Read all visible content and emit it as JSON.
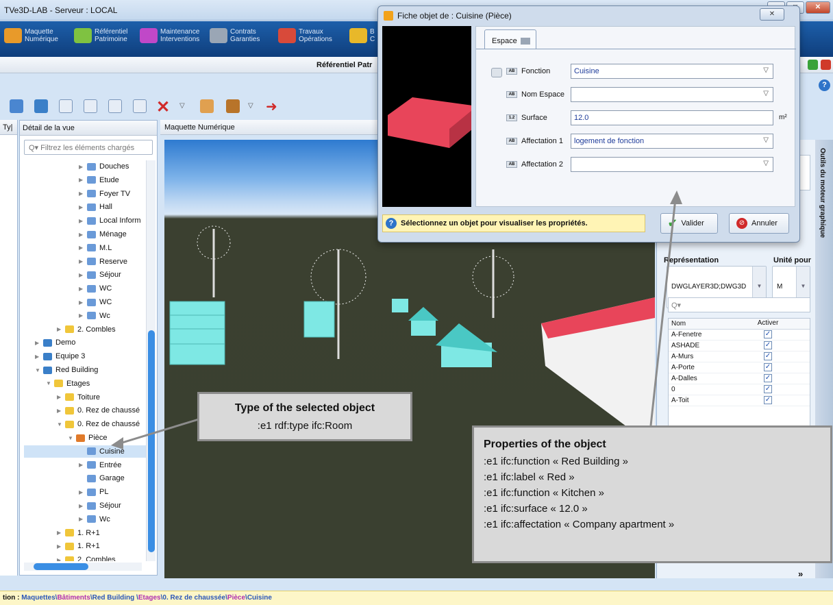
{
  "window": {
    "title": "TVe3D-LAB - Serveur : LOCAL"
  },
  "modules": [
    {
      "line1": "Maquette",
      "line2": "Numérique",
      "color": "#e89a2a"
    },
    {
      "line1": "Référentiel",
      "line2": "Patrimoine",
      "color": "#7fc241"
    },
    {
      "line1": "Maintenance",
      "line2": "Interventions",
      "color": "#c048c8"
    },
    {
      "line1": "Contrats",
      "line2": "Garanties",
      "color": "#9aa6b5"
    },
    {
      "line1": "Travaux",
      "line2": "Opérations",
      "color": "#d84a3a"
    },
    {
      "line1": "B",
      "line2": "C",
      "color": "#e8b82a"
    }
  ],
  "header": {
    "title": "Référentiel Patr"
  },
  "panes": {
    "narrow_title": "Ty|",
    "tree_title": "Détail de la vue",
    "filter_placeholder": "Filtrez les éléments chargés",
    "viewport_title": "Maquette Numérique"
  },
  "tree": [
    {
      "label": "Douches",
      "indent": 80,
      "arrow": "▶",
      "type": "room"
    },
    {
      "label": "Etude",
      "indent": 80,
      "arrow": "▶",
      "type": "room"
    },
    {
      "label": "Foyer TV",
      "indent": 80,
      "arrow": "▶",
      "type": "room"
    },
    {
      "label": "Hall",
      "indent": 80,
      "arrow": "▶",
      "type": "room"
    },
    {
      "label": "Local Inform",
      "indent": 80,
      "arrow": "▶",
      "type": "room"
    },
    {
      "label": "Ménage",
      "indent": 80,
      "arrow": "▶",
      "type": "room"
    },
    {
      "label": "M.L",
      "indent": 80,
      "arrow": "▶",
      "type": "room"
    },
    {
      "label": "Reserve",
      "indent": 80,
      "arrow": "▶",
      "type": "room"
    },
    {
      "label": "Séjour",
      "indent": 80,
      "arrow": "▶",
      "type": "room"
    },
    {
      "label": "WC",
      "indent": 80,
      "arrow": "▶",
      "type": "room"
    },
    {
      "label": "WC",
      "indent": 80,
      "arrow": "▶",
      "type": "room"
    },
    {
      "label": "Wc",
      "indent": 80,
      "arrow": "▶",
      "type": "room"
    },
    {
      "label": "2. Combles",
      "indent": 48,
      "arrow": "▶",
      "type": "folder"
    },
    {
      "label": "Demo",
      "indent": 16,
      "arrow": "▶",
      "type": "bldg"
    },
    {
      "label": "Equipe 3",
      "indent": 16,
      "arrow": "▶",
      "type": "bldg"
    },
    {
      "label": "Red Building",
      "indent": 16,
      "arrow": "▼",
      "type": "bldg"
    },
    {
      "label": "Etages",
      "indent": 32,
      "arrow": "▼",
      "type": "folder"
    },
    {
      "label": "Toiture",
      "indent": 48,
      "arrow": "▶",
      "type": "folder"
    },
    {
      "label": "0. Rez de chaussé",
      "indent": 48,
      "arrow": "▶",
      "type": "folder"
    },
    {
      "label": "0. Rez de chaussé",
      "indent": 48,
      "arrow": "▼",
      "type": "folder"
    },
    {
      "label": "Pièce",
      "indent": 64,
      "arrow": "▼",
      "type": "piece"
    },
    {
      "label": "Cuisine",
      "indent": 80,
      "arrow": "",
      "type": "room",
      "selected": true
    },
    {
      "label": "Entrée",
      "indent": 80,
      "arrow": "▶",
      "type": "room"
    },
    {
      "label": "Garage",
      "indent": 80,
      "arrow": "",
      "type": "room"
    },
    {
      "label": "PL",
      "indent": 80,
      "arrow": "▶",
      "type": "room"
    },
    {
      "label": "Séjour",
      "indent": 80,
      "arrow": "▶",
      "type": "room"
    },
    {
      "label": "Wc",
      "indent": 80,
      "arrow": "▶",
      "type": "room"
    },
    {
      "label": "1. R+1",
      "indent": 48,
      "arrow": "▶",
      "type": "folder"
    },
    {
      "label": "1. R+1",
      "indent": 48,
      "arrow": "▶",
      "type": "folder"
    },
    {
      "label": "2. Combles",
      "indent": 48,
      "arrow": "▶",
      "type": "folder"
    }
  ],
  "right_panel": {
    "representation_label": "Représentation",
    "unit_label": "Unité pour",
    "representation_value": "DWGLAYER3D;DWG3D",
    "unit_value": "M",
    "search_placeholder": "Q▾",
    "col_name": "Nom",
    "col_active": "Activer",
    "layers": [
      "A-Fenetre",
      "ASHADE",
      "A-Murs",
      "A-Porte",
      "A-Dalles",
      "0",
      "A-Toit"
    ],
    "side_tab": "Outils du moteur graphique",
    "expand": "»"
  },
  "dialog": {
    "title": "Fiche objet de : Cuisine (Pièce)",
    "tab": "Espace",
    "fields": [
      {
        "tag": "AB",
        "label": "Fonction",
        "value": "Cuisine",
        "dropdown": true,
        "unit": ""
      },
      {
        "tag": "AB",
        "label": "Nom Espace",
        "value": "",
        "dropdown": true,
        "unit": ""
      },
      {
        "tag": "1.2",
        "label": "Surface",
        "value": "12.0",
        "dropdown": false,
        "unit": "m²"
      },
      {
        "tag": "AB",
        "label": "Affectation 1",
        "value": "logement de fonction",
        "dropdown": true,
        "unit": ""
      },
      {
        "tag": "AB",
        "label": "Affectation 2",
        "value": "",
        "dropdown": true,
        "unit": ""
      }
    ],
    "hint": "Sélectionnez un objet pour visualiser les propriétés.",
    "ok": "Valider",
    "cancel": "Annuler"
  },
  "status": {
    "prefix": "tion : ",
    "path": [
      {
        "t": "Maquettes",
        "c": "#2a56b8"
      },
      {
        "t": "\\",
        "c": "#2a56b8"
      },
      {
        "t": "Bâtiments",
        "c": "#b030b0"
      },
      {
        "t": "\\",
        "c": "#2a56b8"
      },
      {
        "t": "Red Building ",
        "c": "#2a56b8"
      },
      {
        "t": "\\",
        "c": "#2a56b8"
      },
      {
        "t": "Etages",
        "c": "#b030b0"
      },
      {
        "t": "\\",
        "c": "#2a56b8"
      },
      {
        "t": "0. Rez de chaussée",
        "c": "#2a56b8"
      },
      {
        "t": "\\",
        "c": "#2a56b8"
      },
      {
        "t": "Pièce",
        "c": "#b030b0"
      },
      {
        "t": "\\",
        "c": "#2a56b8"
      },
      {
        "t": "Cuisine",
        "c": "#2a56b8"
      }
    ]
  },
  "annotations": {
    "type_box": {
      "heading": "Type of the selected object",
      "line": ":e1   rdf:type   ifc:Room"
    },
    "props_box": {
      "heading": "Properties of the object",
      "lines": [
        ":e1   ifc:function   « Red Building »",
        ":e1   ifc:label   « Red »",
        ":e1   ifc:function   « Kitchen »",
        ":e1   ifc:surface   « 12.0 »",
        ":e1   ifc:affectation   « Company apartment »"
      ]
    }
  },
  "colors": {
    "accent": "#1d5faa",
    "selection": "#cfe3f7",
    "room_red": "#e8455a",
    "building_cyan": "#7ee8e4"
  }
}
